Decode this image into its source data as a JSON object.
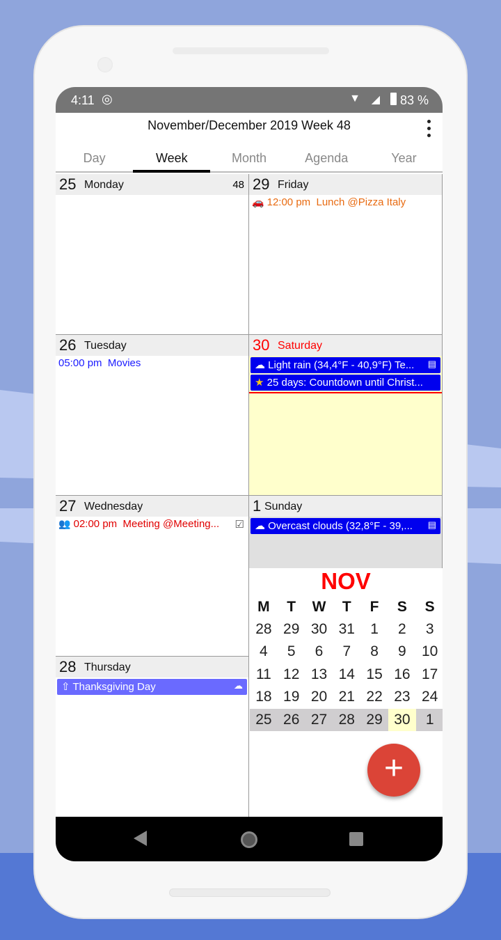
{
  "status": {
    "time": "4:11",
    "battery": "83 %",
    "icons": [
      "sync-icon",
      "wifi-icon",
      "signal-icon",
      "battery-charging-icon"
    ]
  },
  "header": {
    "title": "November/December 2019 Week 48",
    "menu_icon": "more-vert-icon"
  },
  "tabs": [
    {
      "label": "Day"
    },
    {
      "label": "Week",
      "active": true
    },
    {
      "label": "Month"
    },
    {
      "label": "Agenda"
    },
    {
      "label": "Year"
    }
  ],
  "days": [
    {
      "num": "25",
      "name": "Monday",
      "week": "48"
    },
    {
      "num": "26",
      "name": "Tuesday",
      "events": [
        {
          "time": "05:00 pm",
          "title": "Movies",
          "color": "#1a1aff"
        }
      ]
    },
    {
      "num": "27",
      "name": "Wednesday",
      "events": [
        {
          "time": "02:00 pm",
          "title": "Meeting @Meeting...",
          "color": "#e00000",
          "icon": "people-icon"
        }
      ]
    },
    {
      "num": "28",
      "name": "Thursday",
      "bars": [
        {
          "title": "Thanksgiving Day",
          "color": "#6a6aff",
          "icon": "cloud-upload-icon"
        }
      ]
    },
    {
      "num": "29",
      "name": "Friday",
      "events": [
        {
          "time": "12:00 pm",
          "title": "Lunch @Pizza Italy",
          "color": "#e86a10",
          "icon": "car-icon"
        }
      ]
    },
    {
      "num": "30",
      "name": "Saturday",
      "today": true,
      "bars": [
        {
          "title": "Light rain (34,4°F - 40,9°F) Te...",
          "color": "#0000ee",
          "icon": "rain-icon"
        },
        {
          "title": "25 days: Countdown until Christ...",
          "color": "#0000ee",
          "icon": "star-icon"
        }
      ]
    },
    {
      "num": "1",
      "name": "Sunday",
      "bars": [
        {
          "title": "Overcast clouds (32,8°F - 39,...",
          "color": "#0000ee",
          "icon": "cloud-icon"
        }
      ]
    }
  ],
  "mini": {
    "month": "NOV",
    "weekdays": [
      "M",
      "T",
      "W",
      "T",
      "F",
      "S",
      "S"
    ],
    "weeks": [
      [
        "28",
        "29",
        "30",
        "31",
        "1",
        "2",
        "3"
      ],
      [
        "4",
        "5",
        "6",
        "7",
        "8",
        "9",
        "10"
      ],
      [
        "11",
        "12",
        "13",
        "14",
        "15",
        "16",
        "17"
      ],
      [
        "18",
        "19",
        "20",
        "21",
        "22",
        "23",
        "24"
      ],
      [
        "25",
        "26",
        "27",
        "28",
        "29",
        "30",
        "1"
      ]
    ]
  },
  "fab": {
    "label": "+"
  },
  "colors": {
    "today": "#ff0000",
    "today_bg": "#ffffcc",
    "next_month_bg": "#e0e0e0",
    "fab": "#db4437"
  }
}
